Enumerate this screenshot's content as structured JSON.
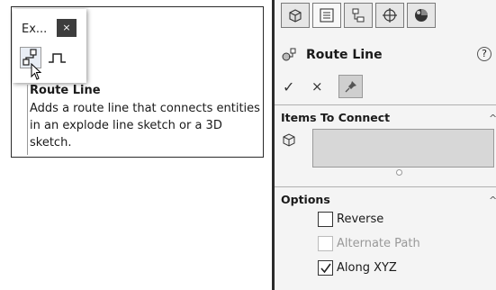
{
  "tooltip": {
    "flyout_title": "Ex...",
    "close_glyph": "×",
    "title": "Route Line",
    "description": "Adds a route line that connects entities in an explode line sketch or a 3D sketch."
  },
  "property_manager": {
    "tabs": [
      {
        "icon": "feature-manager-icon"
      },
      {
        "icon": "property-manager-icon"
      },
      {
        "icon": "configuration-manager-icon"
      },
      {
        "icon": "dimxpert-manager-icon"
      },
      {
        "icon": "display-manager-icon"
      }
    ],
    "title": "Route Line",
    "help_glyph": "?",
    "ok_glyph": "✓",
    "cancel_glyph": "×",
    "sections": {
      "items_to_connect": {
        "label": "Items To Connect",
        "collapse_glyph": "^"
      },
      "options": {
        "label": "Options",
        "collapse_glyph": "^",
        "checkboxes": [
          {
            "label": "Reverse",
            "checked": false,
            "enabled": true
          },
          {
            "label": "Alternate Path",
            "checked": false,
            "enabled": false
          },
          {
            "label": "Along XYZ",
            "checked": true,
            "enabled": true
          }
        ]
      }
    }
  }
}
